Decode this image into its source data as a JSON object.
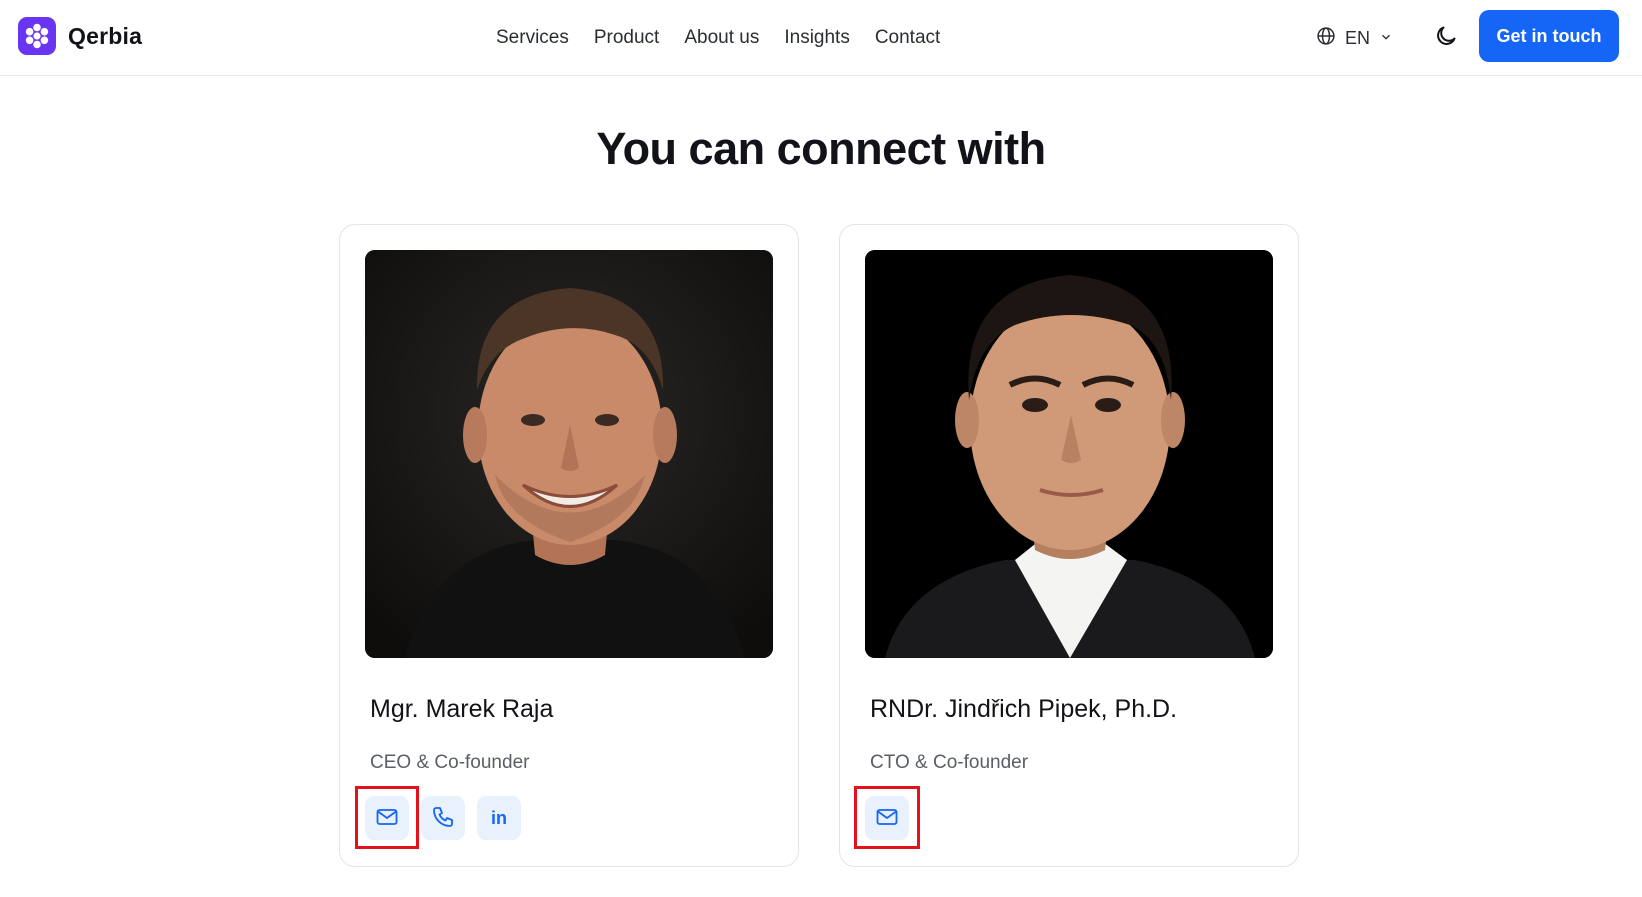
{
  "brand": {
    "name": "Qerbia",
    "color": "#6a35f2"
  },
  "nav": {
    "items": [
      "Services",
      "Product",
      "About us",
      "Insights",
      "Contact"
    ]
  },
  "language": {
    "current": "EN",
    "icon": "globe-icon"
  },
  "theme_toggle": {
    "icon": "moon-icon"
  },
  "cta": {
    "label": "Get in touch",
    "color": "#1565f6"
  },
  "section": {
    "title": "You can connect with"
  },
  "people": [
    {
      "name": "Mgr. Marek Raja",
      "role": "CEO & Co-founder",
      "contacts": [
        "email-icon",
        "phone-icon",
        "linkedin-icon"
      ],
      "linkedin_label": "in"
    },
    {
      "name": "RNDr. Jindřich Pipek, Ph.D.",
      "role": "CTO & Co-founder",
      "contacts": [
        "email-icon"
      ]
    }
  ],
  "highlight_color": "#e4101a"
}
